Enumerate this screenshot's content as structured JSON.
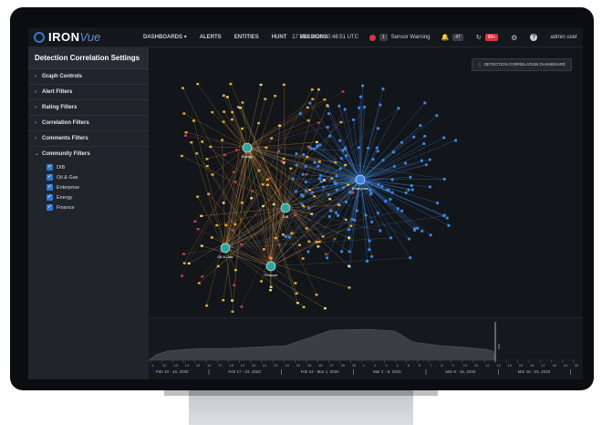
{
  "topbar": {
    "logo_iron": "IRON",
    "logo_vue": "Vue",
    "nav": [
      "DASHBOARDS ▾",
      "ALERTS",
      "ENTITIES",
      "HUNT",
      "SESSIONS"
    ],
    "date": "17 Mar 2020 20:48:51 UTC",
    "warning_count": "1",
    "warning_label": "Sensor Warning",
    "alerts_badge": "47",
    "refresh_badge": "99+",
    "user": "admin user"
  },
  "sidebar": {
    "title": "Detection Correlation Settings",
    "filters": [
      "Graph Controls",
      "Alert Filters",
      "Rating Filters",
      "Correlation Filters",
      "Comments Filters"
    ],
    "community_filters": "Community Filters",
    "communities": [
      "DIB",
      "Oil & Gas",
      "Enterprise",
      "Energy",
      "Finance"
    ]
  },
  "graph": {
    "dashboard_button": "DETECTION CORRELATION DASHBOARD",
    "hubs": [
      "Energy",
      "Enterprise",
      "DIB",
      "Oil & Gas",
      "Finance"
    ],
    "colors": {
      "blue": "#3d86e0",
      "orange": "#e6a93b",
      "red": "#c8443f",
      "teal": "#2ea6a0"
    }
  },
  "timeline": {
    "ticks": [
      "1",
      "12",
      "13",
      "14",
      "15",
      "16",
      "17",
      "18",
      "19",
      "20",
      "21",
      "22",
      "23",
      "24",
      "25",
      "26",
      "27",
      "28",
      "29",
      "1",
      "2",
      "3",
      "4",
      "5",
      "6",
      "7",
      "8",
      "9",
      "10",
      "11",
      "12",
      "13",
      "14",
      "15",
      "16",
      "17",
      "18",
      "19",
      "20"
    ],
    "ranges": [
      "Feb 10 - 16, 2020",
      "Feb 17 - 23, 2020",
      "Feb 24 - Mar 1, 2020",
      "Mar 2 - 8, 2020",
      "Mar 9 - 15, 2020",
      "Mar 16 - 22, 2020"
    ]
  }
}
